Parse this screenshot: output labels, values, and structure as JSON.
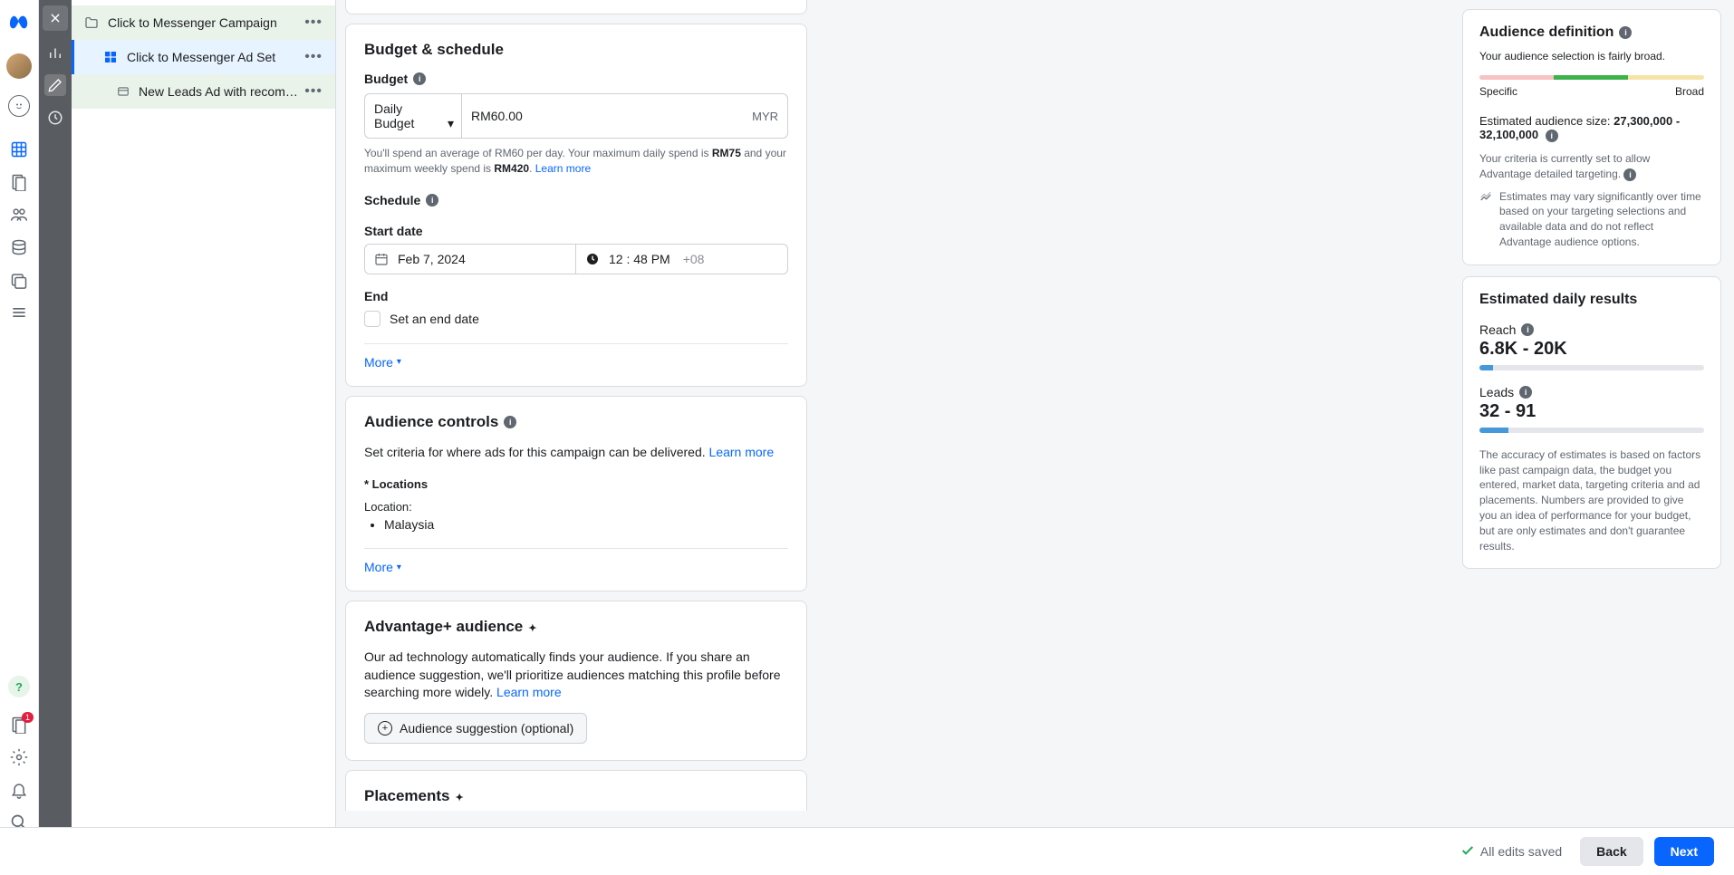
{
  "tree": {
    "campaign": "Click to Messenger Campaign",
    "adset": "Click to Messenger Ad Set",
    "ad": "New Leads Ad with recommend…"
  },
  "budget": {
    "section_title": "Budget & schedule",
    "budget_label": "Budget",
    "budget_type": "Daily Budget",
    "amount": "RM60.00",
    "currency": "MYR",
    "note_pre": "You'll spend an average of RM60 per day. Your maximum daily spend is ",
    "max_daily": "RM75",
    "note_mid": " and your maximum weekly spend is ",
    "max_weekly": "RM420",
    "note_post": ". ",
    "learn_more": "Learn more",
    "schedule_label": "Schedule",
    "start_label": "Start date",
    "start_date": "Feb 7, 2024",
    "start_time_h": "12",
    "start_time_m": "48",
    "start_time_ampm": "PM",
    "start_tz": "+08",
    "end_label": "End",
    "end_checkbox": "Set an end date",
    "more": "More"
  },
  "audience_controls": {
    "title": "Audience controls",
    "desc": "Set criteria for where ads for this campaign can be delivered. ",
    "learn_more": "Learn more",
    "locations_label": "* Locations",
    "location_line": "Location:",
    "locations": [
      "Malaysia"
    ],
    "more": "More"
  },
  "advantage": {
    "title": "Advantage+ audience",
    "desc": "Our ad technology automatically finds your audience. If you share an audience suggestion, we'll prioritize audiences matching this profile before searching more widely. ",
    "learn_more": "Learn more",
    "button": "Audience suggestion (optional)"
  },
  "placements": {
    "title": "Placements"
  },
  "definition": {
    "title": "Audience definition",
    "subtitle": "Your audience selection is fairly broad.",
    "specific": "Specific",
    "broad": "Broad",
    "est_label": "Estimated audience size: ",
    "est_value": "27,300,000 - 32,100,000",
    "criteria_note": "Your criteria is currently set to allow Advantage detailed targeting. ",
    "variance_note": "Estimates may vary significantly over time based on your targeting selections and available data and do not reflect Advantage audience options."
  },
  "daily_results": {
    "title": "Estimated daily results",
    "reach_label": "Reach",
    "reach_value": "6.8K - 20K",
    "reach_pct": 6,
    "leads_label": "Leads",
    "leads_value": "32 - 91",
    "leads_pct": 13,
    "disclaimer": "The accuracy of estimates is based on factors like past campaign data, the budget you entered, market data, targeting criteria and ad placements. Numbers are provided to give you an idea of performance for your budget, but are only estimates and don't guarantee results."
  },
  "footer": {
    "saved": "All edits saved",
    "back": "Back",
    "next": "Next"
  },
  "nav_badge": "1"
}
